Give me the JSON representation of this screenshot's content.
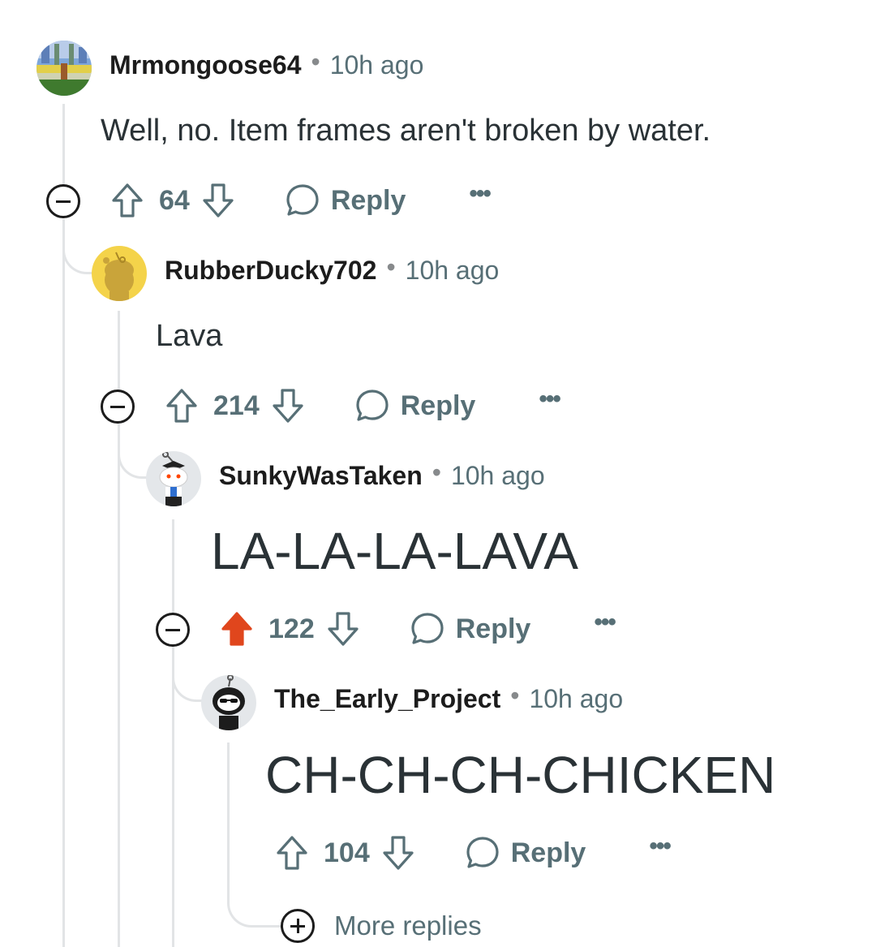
{
  "colors": {
    "upvoted": "#e0461d",
    "muted": "#576f76",
    "thread_line": "#e2e4e6"
  },
  "comments": [
    {
      "username": "Mrmongoose64",
      "time": "10h ago",
      "body": "Well, no. Item frames aren't broken by water.",
      "score": "64",
      "upvoted": false,
      "reply_label": "Reply",
      "more_label": "•••",
      "avatar_icon": "pixel-scene-avatar-icon"
    },
    {
      "username": "RubberDucky702",
      "time": "10h ago",
      "body": "Lava",
      "score": "214",
      "upvoted": false,
      "reply_label": "Reply",
      "more_label": "•••",
      "avatar_icon": "snoo-yellow-avatar-icon"
    },
    {
      "username": "SunkyWasTaken",
      "time": "10h ago",
      "body": "LA-LA-LA-LAVA",
      "score": "122",
      "upvoted": true,
      "reply_label": "Reply",
      "more_label": "•••",
      "avatar_icon": "snoo-grad-cap-avatar-icon"
    },
    {
      "username": "The_Early_Project",
      "time": "10h ago",
      "body": "CH-CH-CH-CHICKEN",
      "score": "104",
      "upvoted": false,
      "reply_label": "Reply",
      "more_label": "•••",
      "avatar_icon": "snoo-sunglasses-avatar-icon"
    }
  ],
  "separator": "•",
  "more_replies_label": "More replies"
}
